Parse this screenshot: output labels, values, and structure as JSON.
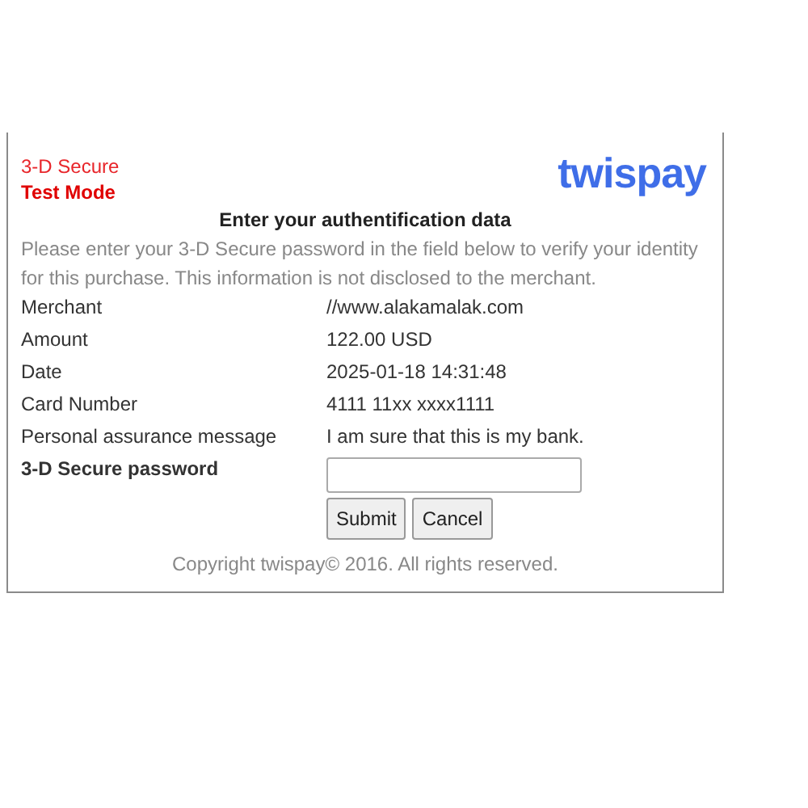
{
  "header": {
    "title": "3-D Secure",
    "mode": "Test Mode",
    "logo": "twispay"
  },
  "heading": "Enter your authentification data",
  "intro": "Please enter your 3-D Secure password in the field below to verify your identity for this purchase. This information is not disclosed to the merchant.",
  "details": [
    {
      "label": "Merchant",
      "value": "//www.alakamalak.com"
    },
    {
      "label": "Amount",
      "value": "122.00 USD"
    },
    {
      "label": "Date",
      "value": "2025-01-18 14:31:48"
    },
    {
      "label": "Card Number",
      "value": "4111 11xx xxxx1111"
    },
    {
      "label": "Personal assurance message",
      "value": "I am sure that this is my bank."
    }
  ],
  "password": {
    "label": "3-D Secure password"
  },
  "buttons": [
    "Submit",
    "Cancel"
  ],
  "footer": "Copyright twispay© 2016. All rights reserved."
}
